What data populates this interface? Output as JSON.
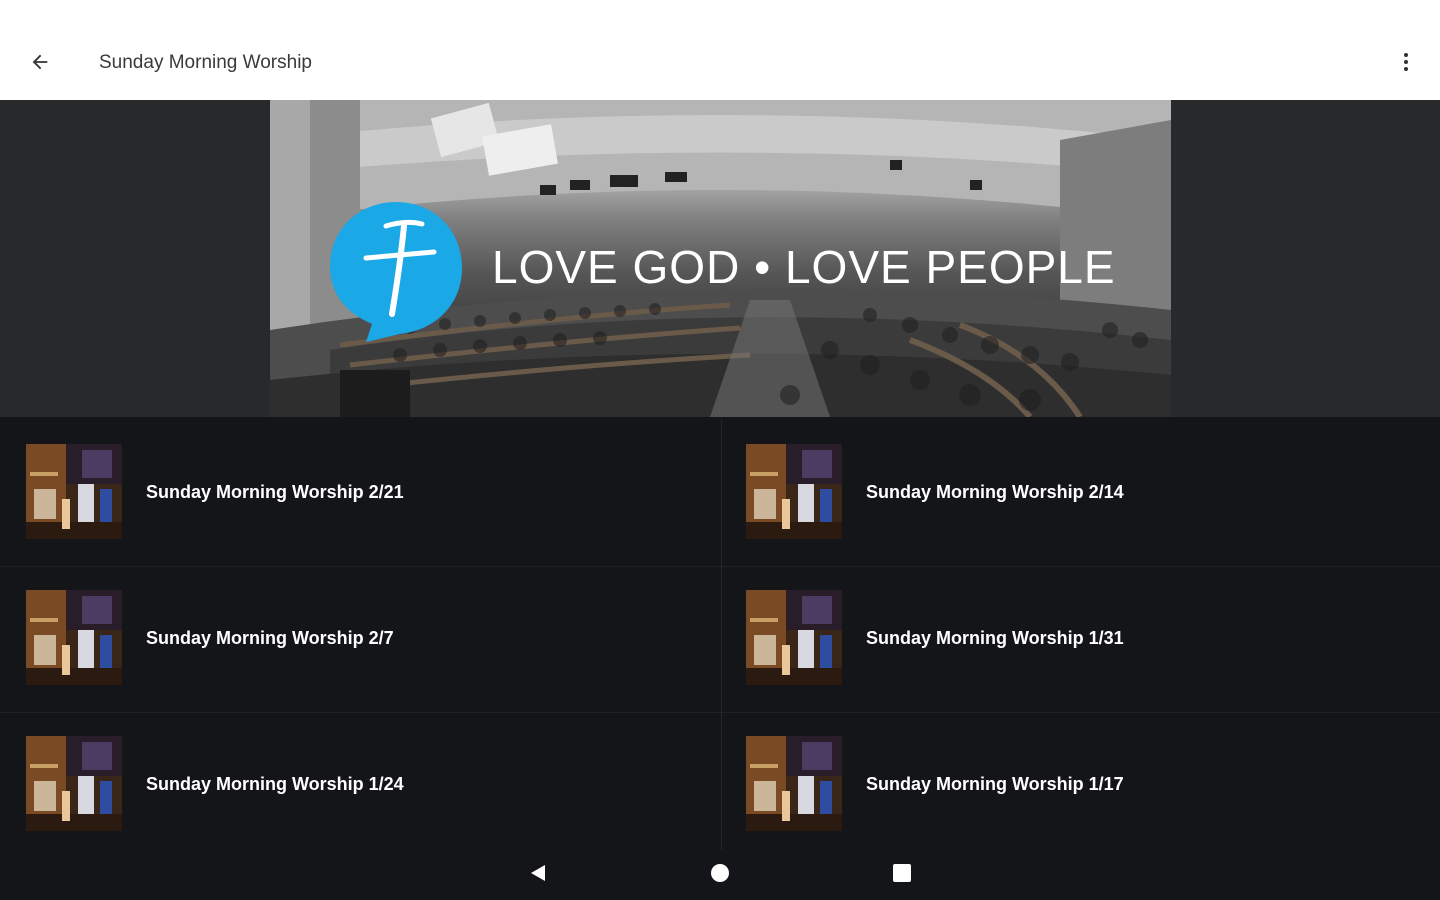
{
  "appbar": {
    "title": "Sunday Morning Worship",
    "back_icon": "arrow-back-icon",
    "menu_icon": "more-vert-icon"
  },
  "banner": {
    "text": "LOVE GOD • LOVE PEOPLE",
    "logo_icon": "church-logo-icon",
    "logo_color": "#1aa8e6"
  },
  "sermons": [
    {
      "title": "Sunday Morning Worship 2/21"
    },
    {
      "title": "Sunday Morning Worship 2/14"
    },
    {
      "title": "Sunday Morning Worship 2/7"
    },
    {
      "title": "Sunday Morning Worship 1/31"
    },
    {
      "title": "Sunday Morning Worship 1/24"
    },
    {
      "title": "Sunday Morning Worship 1/17"
    }
  ],
  "navbar": {
    "back_icon": "nav-back-icon",
    "home_icon": "nav-home-icon",
    "recents_icon": "nav-recents-icon"
  },
  "colors": {
    "appbar_bg": "#ffffff",
    "list_bg": "#141518",
    "text_primary": "#ffffff"
  }
}
